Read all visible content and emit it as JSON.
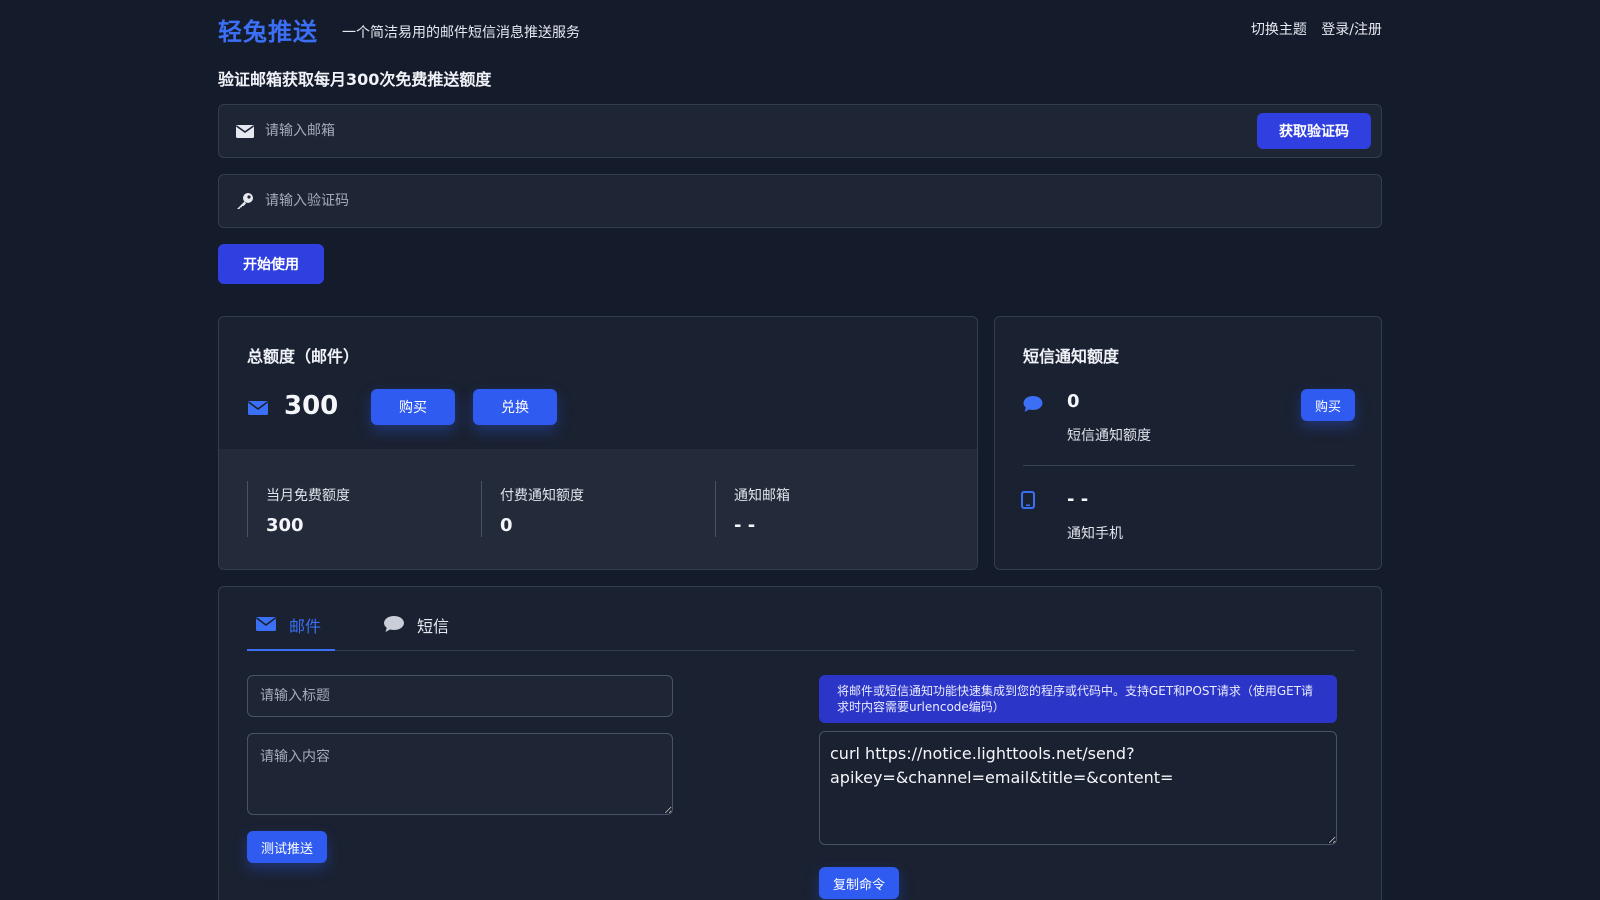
{
  "header": {
    "brand": "轻兔推送",
    "tagline": "一个简洁易用的邮件短信消息推送服务",
    "switch_theme": "切换主题",
    "login": "登录/注册"
  },
  "verify": {
    "title": "验证邮箱获取每月300次免费推送额度",
    "email_placeholder": "请输入邮箱",
    "get_code_label": "获取验证码",
    "code_placeholder": "请输入验证码",
    "start_label": "开始使用"
  },
  "total_card": {
    "title": "总额度（邮件）",
    "value": "300",
    "buy_label": "购买",
    "redeem_label": "兑换",
    "stats": [
      {
        "label": "当月免费额度",
        "value": "300"
      },
      {
        "label": "付费通知额度",
        "value": "0"
      },
      {
        "label": "通知邮箱",
        "value": "- -"
      }
    ]
  },
  "sms_card": {
    "title": "短信通知额度",
    "quota_value": "0",
    "quota_label": "短信通知额度",
    "buy_label": "购买",
    "phone_value": "- -",
    "phone_label": "通知手机"
  },
  "send": {
    "tabs": [
      {
        "label": "邮件",
        "icon": "envelope-icon",
        "active": true
      },
      {
        "label": "短信",
        "icon": "chat-bubble-icon",
        "active": false
      }
    ],
    "title_placeholder": "请输入标题",
    "content_placeholder": "请输入内容",
    "test_label": "测试推送",
    "info": "将邮件或短信通知功能快速集成到您的程序或代码中。支持GET和POST请求（使用GET请求时内容需要urlencode编码）",
    "command": "curl https://notice.lighttools.net/send?apikey=&channel=email&title=&content=",
    "copy_label": "复制命令"
  },
  "colors": {
    "background": "#141b2b",
    "card": "#1a2131",
    "accent": "#3b6ff5",
    "primary_button": "#2f3fe0"
  }
}
